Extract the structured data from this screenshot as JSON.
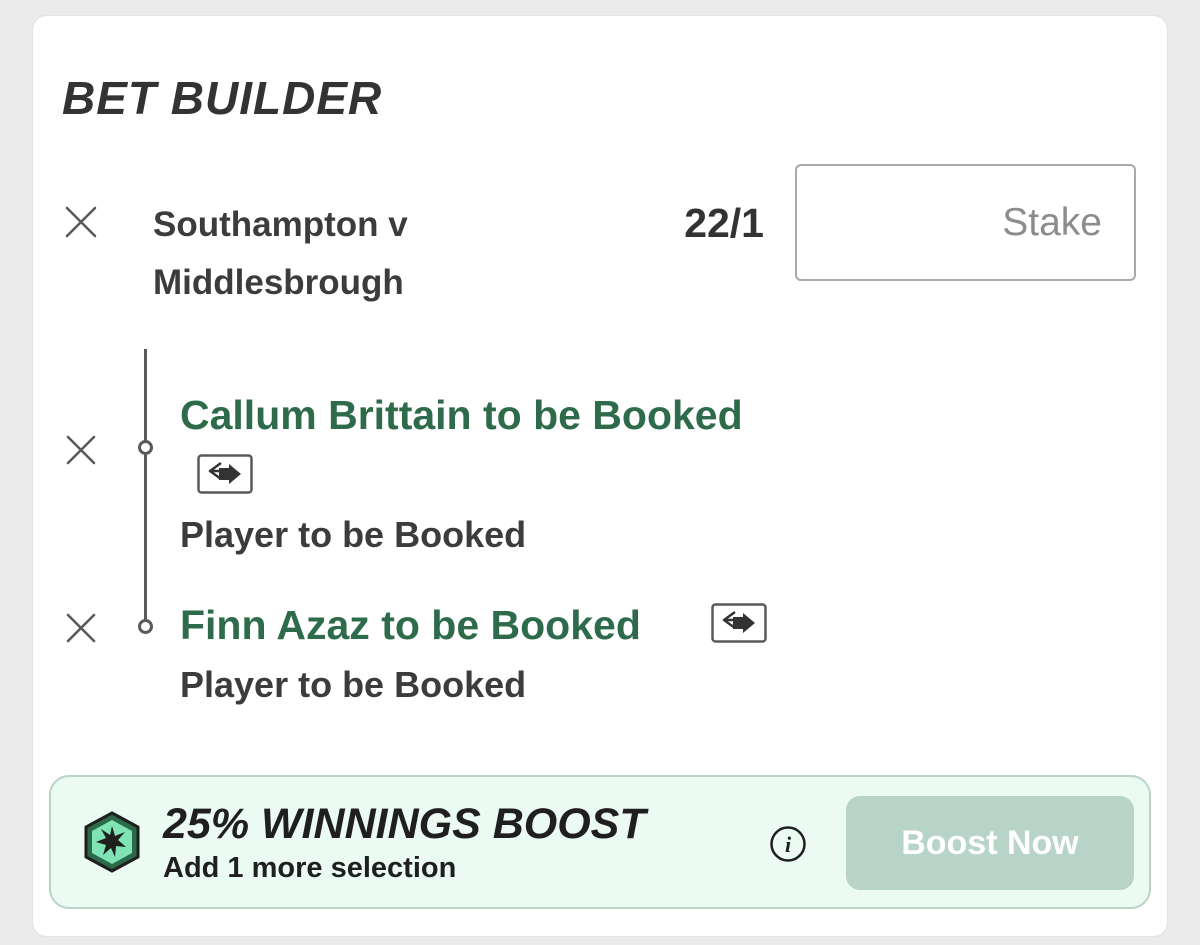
{
  "header": {
    "title": "BET BUILDER"
  },
  "bet": {
    "event_name": "Southampton v Middlesbrough",
    "odds": "22/1",
    "stake_placeholder": "Stake",
    "stake_value": ""
  },
  "selections": [
    {
      "name": "Callum Brittain to be Booked",
      "market": "Player to be Booked"
    },
    {
      "name": "Finn Azaz to be Booked",
      "market": "Player to be Booked"
    }
  ],
  "boost": {
    "title": "25% WINNINGS BOOST",
    "subtitle": "Add 1 more selection",
    "button_label": "Boost Now",
    "info_glyph": "i"
  },
  "icons": {
    "remove": "close-icon",
    "swap": "swap-icon",
    "boost_badge": "boost-badge-icon",
    "info": "info-icon"
  },
  "colors": {
    "selection_green": "#2e6b4a",
    "boost_background": "#ebfbf3",
    "boost_button": "#b8d3c7",
    "badge_fill": "#2b6b4a",
    "badge_inner": "#7fe3b4"
  }
}
